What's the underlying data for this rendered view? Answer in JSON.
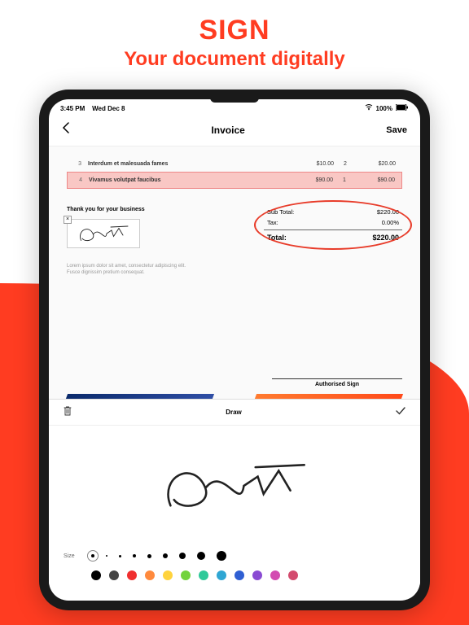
{
  "headline": {
    "sign": "SIGN",
    "sub": "Your document digitally"
  },
  "status": {
    "time": "3:45 PM",
    "date": "Wed Dec 8",
    "battery": "100%"
  },
  "nav": {
    "title": "Invoice",
    "save": "Save"
  },
  "table": {
    "rows": [
      {
        "idx": "3",
        "desc": "Interdum et malesuada fames",
        "price": "$10.00",
        "qty": "2",
        "amount": "$20.00",
        "highlight": false
      },
      {
        "idx": "4",
        "desc": "Vivamus volutpat faucibus",
        "price": "$90.00",
        "qty": "1",
        "amount": "$90.00",
        "highlight": true
      }
    ]
  },
  "thanks": "Thank you for your business",
  "totals": {
    "subtotal_label": "Sub Total:",
    "subtotal": "$220.00",
    "tax_label": "Tax:",
    "tax": "0.00%",
    "total_label": "Total:",
    "total": "$220.00"
  },
  "lorem": "Lorem ipsum dolor sit amet, consectetur adipiscing elit. Fusce dignissim pretium consequat.",
  "auth_label": "Authorised Sign",
  "draw": {
    "title": "Draw",
    "size_label": "Size",
    "sizes": [
      4,
      2,
      3,
      4,
      5,
      6,
      8,
      10,
      12
    ],
    "selected_size_index": 0,
    "colors": [
      "#000000",
      "#444444",
      "#f02f2f",
      "#ff8a3d",
      "#ffd33d",
      "#72d33d",
      "#2fc99a",
      "#2fa6d3",
      "#2f5fd3",
      "#8a4bd3",
      "#d34bb1",
      "#d34b6e"
    ]
  }
}
